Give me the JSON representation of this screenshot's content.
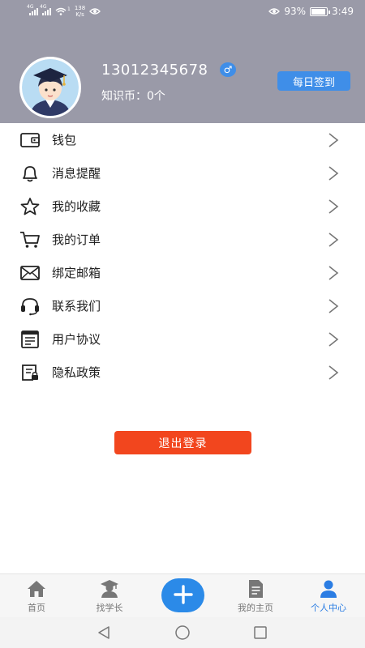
{
  "status_bar": {
    "sim1_label": "4G",
    "sim2_label": "4G",
    "wifi_sup": "1",
    "speed_value": "138",
    "speed_unit": "K/s",
    "battery": "93%",
    "battery_level": 0.93,
    "time": "3:49"
  },
  "profile": {
    "phone": "13012345678",
    "gender_symbol": "♂",
    "coins": "知识币：0个",
    "checkin_label": "每日签到"
  },
  "menu": {
    "items": [
      {
        "label": "钱包",
        "icon": "wallet-icon"
      },
      {
        "label": "消息提醒",
        "icon": "bell-icon"
      },
      {
        "label": "我的收藏",
        "icon": "star-icon"
      },
      {
        "label": "我的订单",
        "icon": "cart-icon"
      },
      {
        "label": "绑定邮箱",
        "icon": "mail-icon"
      },
      {
        "label": "联系我们",
        "icon": "headset-icon"
      },
      {
        "label": "用户协议",
        "icon": "agreement-icon"
      },
      {
        "label": "隐私政策",
        "icon": "privacy-icon"
      }
    ]
  },
  "logout_label": "退出登录",
  "tabbar": {
    "tabs": [
      {
        "label": "首页",
        "icon": "home-icon"
      },
      {
        "label": "找学长",
        "icon": "graduate-icon"
      },
      {
        "label": "我的主页",
        "icon": "document-icon"
      },
      {
        "label": "个人中心",
        "icon": "user-icon",
        "active": true
      }
    ],
    "add_icon": "plus-icon",
    "active_color": "#2b7de3"
  },
  "colors": {
    "header_bg": "#9a9aa8",
    "accent": "#3f8ee8",
    "logout": "#f2461e"
  }
}
